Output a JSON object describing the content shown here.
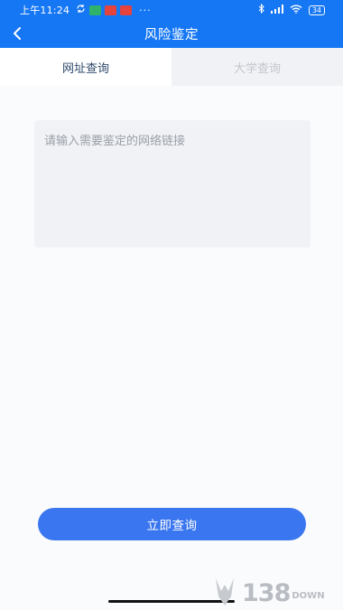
{
  "status_bar": {
    "time": "上午11:24",
    "notification_badges": [
      "green",
      "red",
      "red"
    ],
    "overflow": "···",
    "battery": "34"
  },
  "nav": {
    "title": "风险鉴定",
    "back_icon": "chevron-left-icon"
  },
  "tabs": [
    {
      "label": "网址查询",
      "active": true
    },
    {
      "label": "大学查询",
      "active": false
    }
  ],
  "url_input": {
    "placeholder": "请输入需要鉴定的网络链接",
    "value": ""
  },
  "query_button": {
    "label": "立即查询"
  },
  "watermark": {
    "text": "138",
    "suffix": "DOWN"
  },
  "colors": {
    "header": "#1677f5",
    "button": "#3a76ef",
    "active_tab_text": "#2f4a6b",
    "inactive_tab_text": "#c2c6cd"
  }
}
